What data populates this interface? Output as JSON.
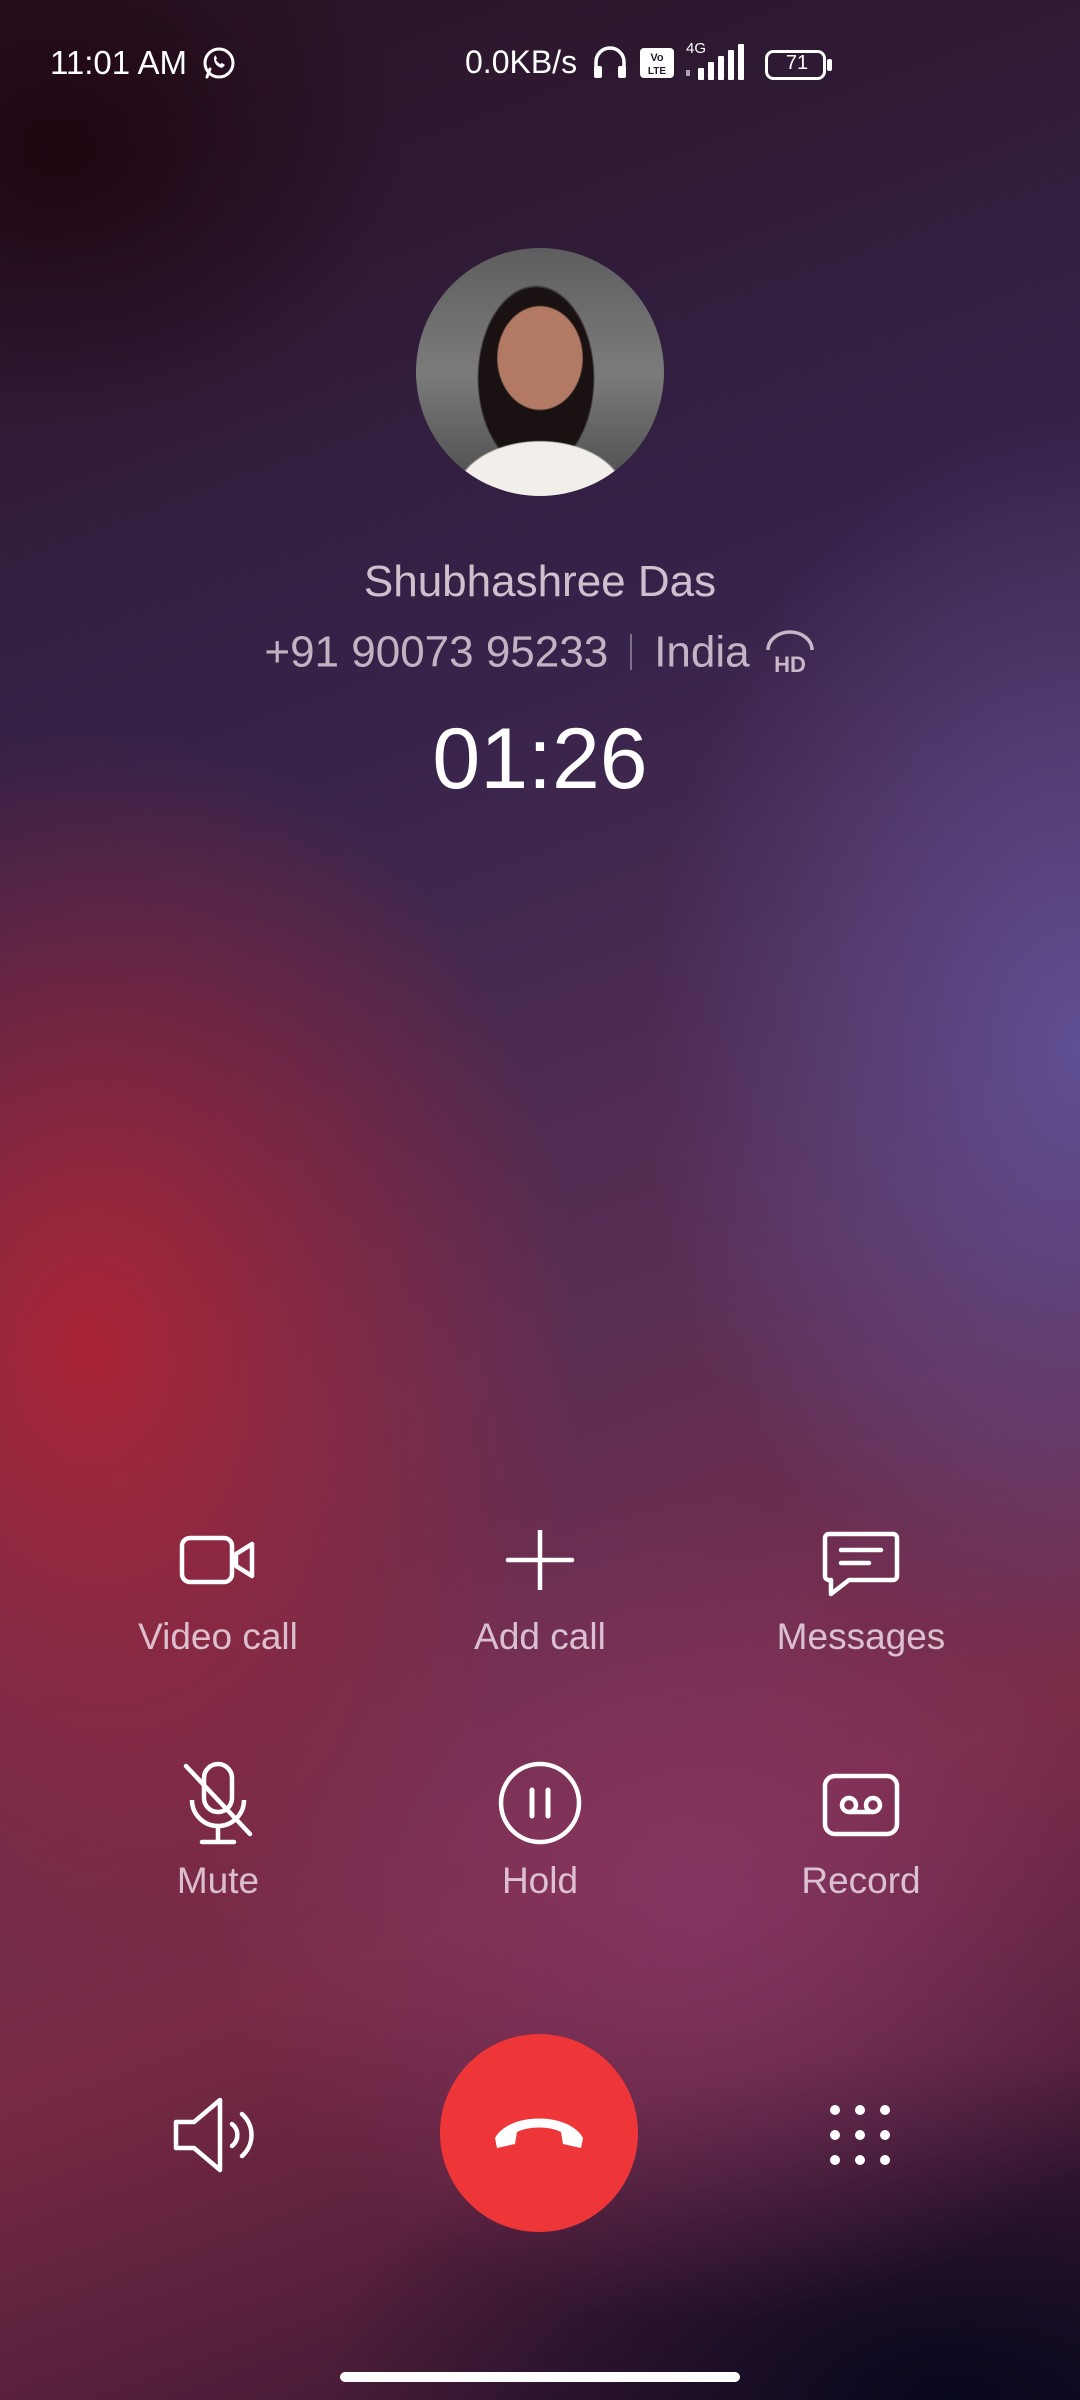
{
  "status_bar": {
    "time": "11:01 AM",
    "net_speed": "0.0KB/s",
    "network_type": "4G",
    "volte": "Vo LTE",
    "battery_level": "71",
    "icons": [
      "whatsapp-icon",
      "headset-icon",
      "volte-icon",
      "signal-icon",
      "battery-icon"
    ]
  },
  "caller": {
    "name": "Shubhashree Das",
    "number": "+91 90073 95233",
    "location": "India",
    "hd_badge": "HD",
    "duration": "01:26"
  },
  "actions": [
    {
      "label": "Video call",
      "icon": "video-call-icon"
    },
    {
      "label": "Add call",
      "icon": "plus-icon"
    },
    {
      "label": "Messages",
      "icon": "message-icon"
    },
    {
      "label": "Mute",
      "icon": "mic-off-icon"
    },
    {
      "label": "Hold",
      "icon": "pause-icon"
    },
    {
      "label": "Record",
      "icon": "record-icon"
    }
  ],
  "bottom": {
    "icons": [
      "speaker-icon",
      "end-call-icon",
      "dialpad-icon"
    ],
    "end_call_color": "#ee3538"
  }
}
